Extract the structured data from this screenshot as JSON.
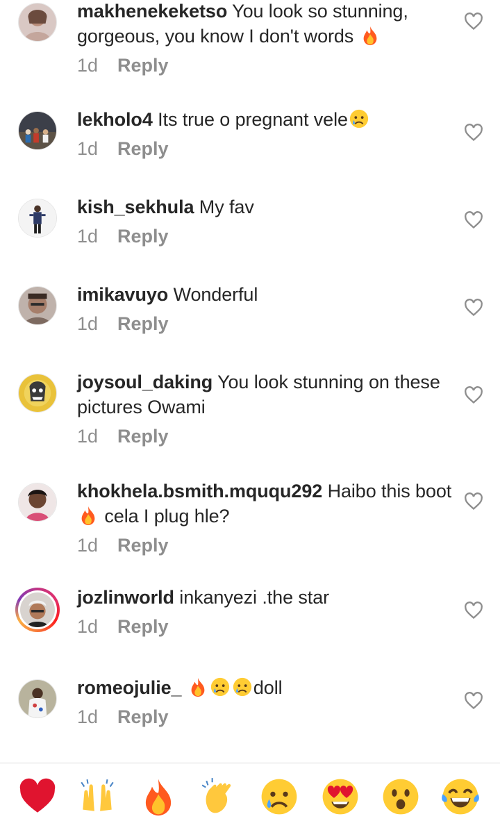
{
  "comments": [
    {
      "username": "makhenekeketso",
      "text": " You look so stunning, gorgeous, you know I don't words ",
      "emoji_after": "fire",
      "time": "1d",
      "reply": "Reply"
    },
    {
      "username": "lekholo4",
      "text": " Its true o pregnant vele",
      "emoji_after": "sad-tear",
      "time": "1d",
      "reply": "Reply"
    },
    {
      "username": "kish_sekhula",
      "text": " My fav",
      "time": "1d",
      "reply": "Reply"
    },
    {
      "username": "imikavuyo",
      "text": " Wonderful",
      "time": "1d",
      "reply": "Reply"
    },
    {
      "username": "joysoul_daking",
      "text": " You look stunning on these pictures Owami",
      "time": "1d",
      "reply": "Reply"
    },
    {
      "username": "khokhela.bsmith.mququ292",
      "text_a": " Haibo this boot",
      "text_b": " cela I plug hle?",
      "time": "1d",
      "reply": "Reply"
    },
    {
      "username": "jozlinworld",
      "text": " inkanyezi .the star",
      "time": "1d",
      "reply": "Reply"
    },
    {
      "username": "romeojulie_",
      "text": "doll",
      "emoji_before": [
        "fire",
        "sad-tear",
        "sad-tear"
      ],
      "time": "1d",
      "reply": "Reply"
    }
  ],
  "quick_reactions": [
    "red-heart-icon",
    "raising-hands-icon",
    "fire-icon",
    "clapping-hands-icon",
    "sad-tear-icon",
    "heart-eyes-icon",
    "surprised-face-icon",
    "tears-of-joy-icon"
  ],
  "colors": {
    "text": "#262626",
    "meta": "#8e8e8e",
    "divider": "#dbdbdb",
    "story_ring": "#e1306c"
  }
}
